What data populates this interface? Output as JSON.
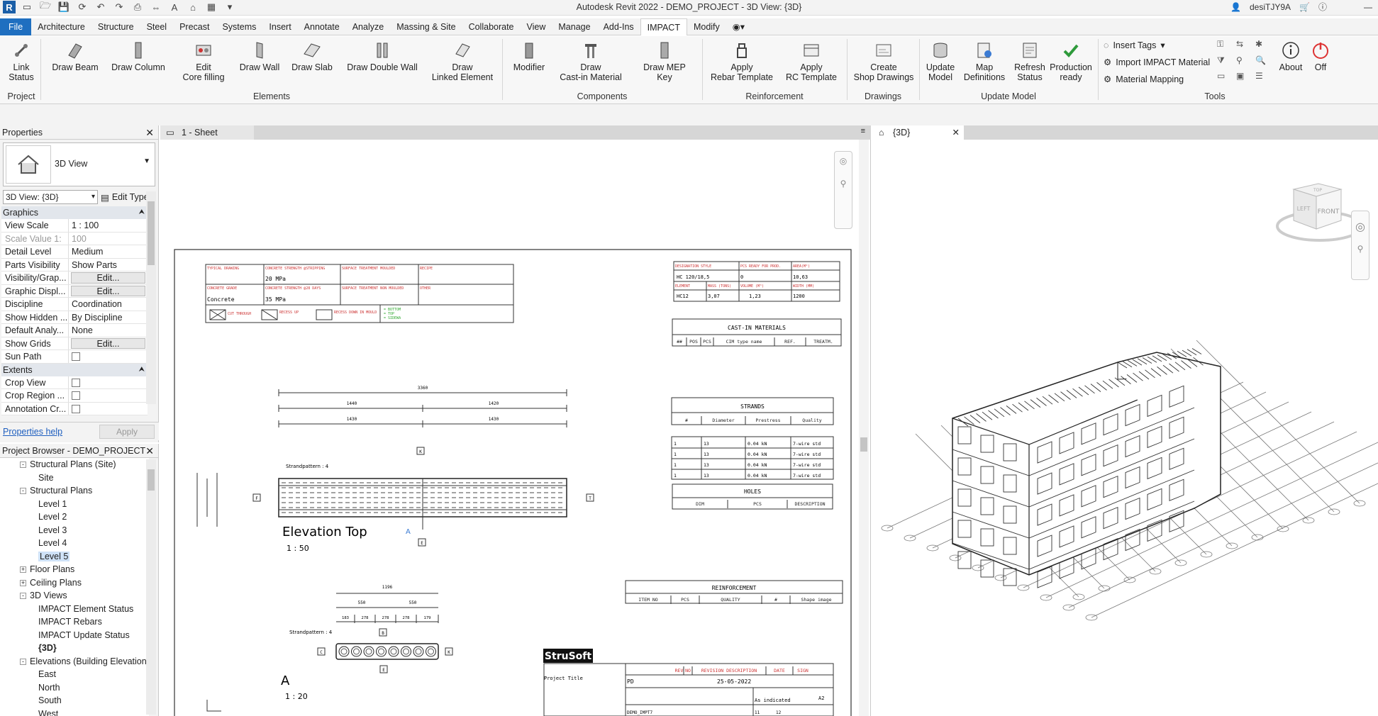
{
  "app": {
    "title": "Autodesk Revit 2022 - DEMO_PROJECT - 3D View: {3D}",
    "user": "desiTJY9A",
    "logo": "R"
  },
  "qat_icons": [
    "open-icon",
    "save-icon",
    "sync-icon",
    "undo-icon",
    "redo-icon",
    "print-icon",
    "measure-icon",
    "text-icon",
    "3d-view-icon",
    "switch-windows-icon"
  ],
  "menu": {
    "tabs": [
      "File",
      "Architecture",
      "Structure",
      "Steel",
      "Precast",
      "Systems",
      "Insert",
      "Annotate",
      "Analyze",
      "Massing & Site",
      "Collaborate",
      "View",
      "Manage",
      "Add-Ins",
      "IMPACT",
      "Modify"
    ],
    "active": "IMPACT"
  },
  "ribbon": {
    "buttons": [
      {
        "label": "Link\nStatus",
        "icon": "link-icon"
      },
      {
        "label": "Draw Beam",
        "icon": "beam-icon"
      },
      {
        "label": "Draw Column",
        "icon": "column-icon"
      },
      {
        "label": "Edit\nCore filling",
        "icon": "core-icon"
      },
      {
        "label": "Draw Wall",
        "icon": "wall-icon"
      },
      {
        "label": "Draw Slab",
        "icon": "slab-icon"
      },
      {
        "label": "Draw Double Wall",
        "icon": "double-wall-icon"
      },
      {
        "label": "Draw\nLinked Element",
        "icon": "linked-element-icon"
      },
      {
        "label": "Modifier",
        "icon": "modifier-icon"
      },
      {
        "label": "Draw\nCast-in Material",
        "icon": "cast-in-icon"
      },
      {
        "label": "Draw MEP Key",
        "icon": "mep-key-icon"
      },
      {
        "label": "Apply\nRebar Template",
        "icon": "rebar-template-icon"
      },
      {
        "label": "Apply\nRC Template",
        "icon": "rc-template-icon"
      },
      {
        "label": "Create\nShop Drawings",
        "icon": "shop-drawings-icon"
      },
      {
        "label": "Update\nModel",
        "icon": "update-model-icon"
      },
      {
        "label": "Map\nDefinitions",
        "icon": "map-definitions-icon"
      },
      {
        "label": "Refresh\nStatus",
        "icon": "refresh-status-icon"
      },
      {
        "label": "Production\nready",
        "icon": "checkmark-icon"
      },
      {
        "label": "About",
        "icon": "info-icon"
      },
      {
        "label": "Off",
        "icon": "power-icon"
      }
    ],
    "panels": [
      "Project",
      "Elements",
      "Components",
      "Reinforcement",
      "Drawings",
      "Update Model",
      "Tools"
    ],
    "tools_items": [
      "Insert  Tags",
      "Import IMPACT  Material",
      "Material  Mapping"
    ]
  },
  "properties": {
    "title": "Properties",
    "type_name": "3D View",
    "view_selector": "3D View: {3D}",
    "edit_type": "Edit Type",
    "sections": {
      "graphics": "Graphics",
      "extents": "Extents"
    },
    "rows": [
      {
        "k": "View Scale",
        "v": "1 : 100"
      },
      {
        "k": "Scale Value    1:",
        "v": "100"
      },
      {
        "k": "Detail Level",
        "v": "Medium"
      },
      {
        "k": "Parts Visibility",
        "v": "Show Parts"
      },
      {
        "k": "Visibility/Grap...",
        "v": "Edit..."
      },
      {
        "k": "Graphic Displ...",
        "v": "Edit..."
      },
      {
        "k": "Discipline",
        "v": "Coordination"
      },
      {
        "k": "Show Hidden ...",
        "v": "By Discipline"
      },
      {
        "k": "Default Analy...",
        "v": "None"
      },
      {
        "k": "Show Grids",
        "v": "Edit..."
      },
      {
        "k": "Sun Path",
        "v": ""
      }
    ],
    "extent_rows": [
      {
        "k": "Crop View",
        "v": ""
      },
      {
        "k": "Crop Region ...",
        "v": ""
      },
      {
        "k": "Annotation Cr...",
        "v": ""
      }
    ],
    "help": "Properties help",
    "apply": "Apply"
  },
  "browser": {
    "title": "Project Browser - DEMO_PROJECT",
    "nodes": [
      {
        "t": "Structural Plans (Site)",
        "l": 1,
        "tg": "-"
      },
      {
        "t": "Site",
        "l": 2
      },
      {
        "t": "Structural Plans",
        "l": 1,
        "tg": "-"
      },
      {
        "t": "Level 1",
        "l": 2
      },
      {
        "t": "Level 2",
        "l": 2
      },
      {
        "t": "Level 3",
        "l": 2
      },
      {
        "t": "Level 4",
        "l": 2
      },
      {
        "t": "Level 5",
        "l": 2,
        "sel": true
      },
      {
        "t": "Floor Plans",
        "l": 1,
        "tg": "+"
      },
      {
        "t": "Ceiling Plans",
        "l": 1,
        "tg": "+"
      },
      {
        "t": "3D Views",
        "l": 1,
        "tg": "-"
      },
      {
        "t": "IMPACT Element Status",
        "l": 2
      },
      {
        "t": "IMPACT Rebars",
        "l": 2
      },
      {
        "t": "IMPACT Update Status",
        "l": 2
      },
      {
        "t": "{3D}",
        "l": 2,
        "bold": true
      },
      {
        "t": "Elevations (Building Elevation",
        "l": 1,
        "tg": "-"
      },
      {
        "t": "East",
        "l": 2
      },
      {
        "t": "North",
        "l": 2
      },
      {
        "t": "South",
        "l": 2
      },
      {
        "t": "West",
        "l": 2
      }
    ]
  },
  "views": {
    "sheet_tab": "1 - Sheet",
    "view3d_tab": "{3D}",
    "viewcube_front": "FRONT",
    "viewcube_left": "LEFT",
    "viewcube_top": "TOP"
  },
  "sheet": {
    "concrete_strength_28": "20 MPa",
    "concrete_grade": "Concrete",
    "concrete_strength_2": "35 MPa",
    "legend": [
      "CUT THROUGH",
      "RECESS UP",
      "RECESS DOWN IN MOULD"
    ],
    "legend_green": [
      "= BOTTOM",
      "= TOP",
      "= SIDEWA"
    ],
    "h1": {
      "label": "TYPICAL DRAWING"
    },
    "h2": {
      "label": "CONCRETE STRENGTH @STRIPPING"
    },
    "h3": {
      "label": "SURFACE TREATMENT MOULDED"
    },
    "h4": {
      "label": "RECIPE"
    },
    "h5": {
      "label": "CONCRETE GRADE"
    },
    "h6": {
      "label": "CONCRETE STRENGTH @28 DAYS"
    },
    "h7": {
      "label": "SURFACE TREATMENT NON MOULDED"
    },
    "h8": {
      "label": "OTHER"
    },
    "info_headers": [
      "DESIGNATION STYLE",
      "PCS READY FOR PROD.",
      "AREA(M²)",
      "ELEMENT",
      "MASS (TONS)",
      "VOLUME (M³)",
      "WIDTH (MM)"
    ],
    "info_values": [
      "HC 120/18,5",
      "0",
      "10,63",
      "HC12",
      "3,07",
      "1,23",
      "1200"
    ],
    "dim_top": "3360",
    "dims_row1": [
      "1440",
      "1420"
    ],
    "dims_row2": [
      "1430",
      "1430"
    ],
    "strandpattern": "Strandpattern : 4",
    "elevation_title": "Elevation Top",
    "elevation_scale": "1 : 50",
    "section_title": "A",
    "section_scale": "1 : 20",
    "section_dim": "1196",
    "section_dims": [
      "550",
      "550"
    ],
    "section_dims2": [
      "183",
      "278",
      "278",
      "278",
      "179"
    ],
    "cast_in": {
      "title": "CAST-IN MATERIALS",
      "headers": [
        "##",
        "POS",
        "PCS",
        "CIM type name",
        "REF.",
        "TREATM."
      ]
    },
    "strands": {
      "title": "STRANDS",
      "headers": [
        "#",
        "Diameter",
        "Prestress",
        "Quality"
      ],
      "rows": [
        [
          "1",
          "13",
          "0.04 kN",
          "7-wire std"
        ],
        [
          "1",
          "13",
          "0.04 kN",
          "7-wire std"
        ],
        [
          "1",
          "13",
          "0.04 kN",
          "7-wire std"
        ],
        [
          "1",
          "13",
          "0.04 kN",
          "7-wire std"
        ]
      ]
    },
    "holes": {
      "title": "HOLES",
      "headers": [
        "DIM",
        "PCS",
        "DESCRIPTION"
      ]
    },
    "reinforcement": {
      "title": "REINFORCEMENT",
      "headers": [
        "ITEM NO",
        "PCS",
        "QUALITY",
        "#",
        "Shape image"
      ]
    },
    "titleblock": {
      "logo": "StruSoft",
      "headers": [
        "REV",
        "NO",
        "REVISION DESCRIPTION",
        "DATE",
        "SIGN"
      ],
      "rev": "PD",
      "date": "25-05-2022",
      "scale": "As indicated",
      "size": "A2",
      "project_title": "Project Title",
      "project_code": "DEMO_IMPT7",
      "sheet_no": "11",
      "sheet_no2": "12"
    },
    "markers": [
      "A",
      "E",
      "F",
      "T",
      "B",
      "C",
      "K"
    ]
  }
}
